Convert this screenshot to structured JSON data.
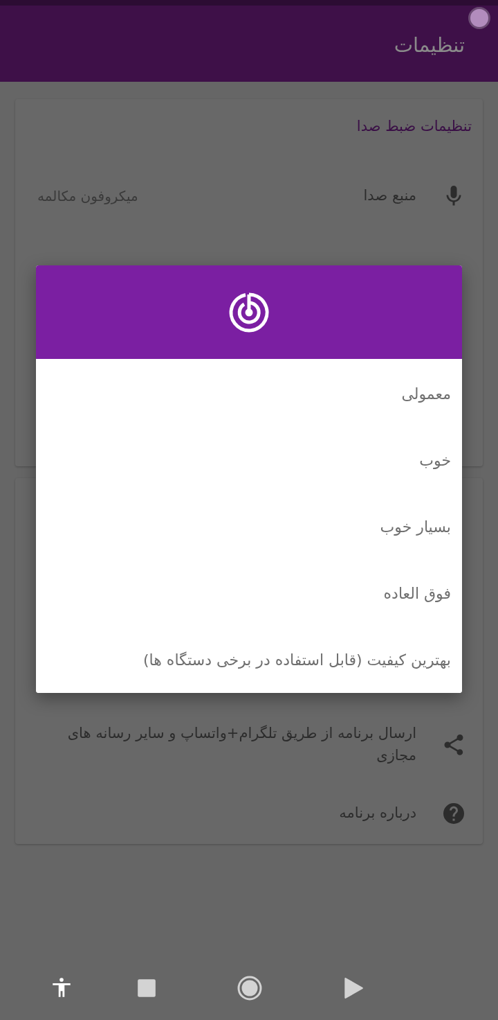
{
  "app_bar": {
    "title": "تنظیمات"
  },
  "recording_card": {
    "title": "تنظیمات ضبط صدا",
    "items": [
      {
        "kind": "mic",
        "label": "منبع صدا",
        "value": "میکروفون مکالمه"
      }
    ]
  },
  "other_card": {
    "items": [
      {
        "kind": "share",
        "label": "ارسال برنامه از طریق تلگرام+واتساپ و سایر رسانه های مجازی"
      },
      {
        "kind": "help",
        "label": "درباره برنامه"
      }
    ]
  },
  "quality_dialog": {
    "options": [
      "معمولی",
      "خوب",
      "بسیار خوب",
      "فوق العاده",
      "بهترین کیفیت (قابل استفاده در برخی دستگاه ها)"
    ]
  }
}
